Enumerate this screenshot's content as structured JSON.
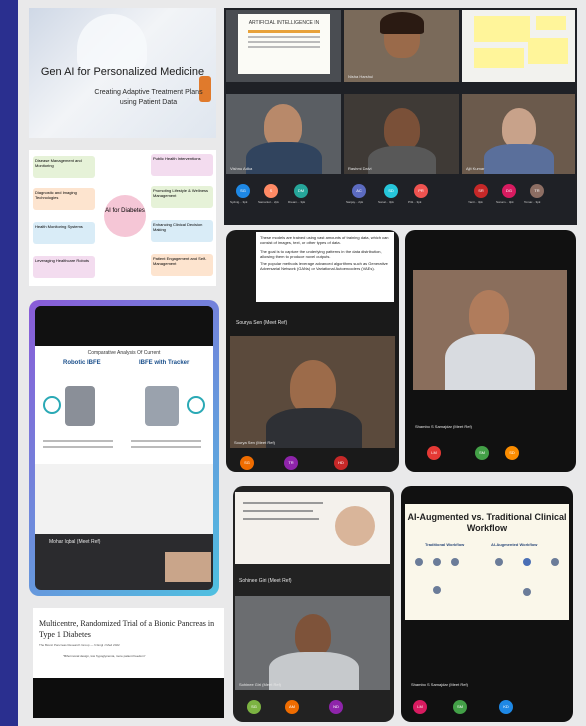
{
  "hero": {
    "title": "Gen AI for Personalized Medicine",
    "subtitle": "Creating Adaptive Treatment Plans using Patient Data"
  },
  "mindmap": {
    "center": "AI for Diabetes",
    "nodes": [
      "Disease Management and Monitoring",
      "Diagnostic and Imaging Technologies",
      "Health Monitoring Systems",
      "Leveraging Healthcare Robots",
      "Public Health Interventions",
      "Promoting Lifestyle & Wellness Management",
      "Enhancing Clinical Decision Making",
      "Patient Engagement and Self-Management"
    ]
  },
  "zoom_top": {
    "slide_title": "ARTIFICIAL INTELLIGENCE IN",
    "participants": [
      "Ashwini Nitin Mulik",
      "Nisha Harshul",
      "Vishnu Adka",
      "Rashmi Dalvi",
      "Sonal Sharma",
      "Ajit Kumar"
    ],
    "avatars": [
      {
        "initials": "SG",
        "label": "Sydnig... 3pk",
        "color": "#1e88e5"
      },
      {
        "initials": "S",
        "label": "Samantol... 2pk",
        "color": "#ff8a65"
      },
      {
        "initials": "DM",
        "label": "Dream... 3pk",
        "color": "#26a69a"
      },
      {
        "initials": "AC",
        "label": "Sanjay... 2pk",
        "color": "#5c6bc0"
      },
      {
        "initials": "SD",
        "label": "Sonal... 3pk",
        "color": "#26c6da"
      },
      {
        "initials": "PR",
        "label": "Priti... 3pk",
        "color": "#ef5350"
      },
      {
        "initials": "SR",
        "label": "Yanir... 3pk",
        "color": "#c62828"
      },
      {
        "initials": "DG",
        "label": "Sonam... 3pk",
        "color": "#d81b60"
      },
      {
        "initials": "TR",
        "label": "Tomar... 3pk",
        "color": "#8d6e63"
      }
    ]
  },
  "tablet_mid": {
    "slide_lines": [
      "These models are trained using vast amounts of training data, which can consist of images, text, or other types of data.",
      "The goal is to capture the underlying patterns in the data distribution, allowing them to produce novel outputs.",
      "The popular methods leverage advanced algorithms such as Generative Adversarial Network (GANs) or Variational Autoencoders (VAEs)."
    ],
    "host": "Sourya Sen (Meet Ref)",
    "tile_name": "Sourya Sen (Meet Ref)",
    "avatars": [
      {
        "initials": "SG",
        "color": "#ef6c00"
      },
      {
        "initials": "TR",
        "color": "#8e24aa"
      },
      {
        "initials": "HD",
        "color": "#c62828"
      }
    ]
  },
  "tablet_right": {
    "tile_name": "Shambo S Samajdar (Meet Ref)",
    "avatars": [
      {
        "initials": "LM",
        "color": "#e53935"
      },
      {
        "initials": "SM",
        "color": "#43a047"
      },
      {
        "initials": "SD",
        "color": "#fb8c00"
      }
    ]
  },
  "comparison": {
    "title": "Comparative Analysis Of Current",
    "col1": "Robotic IBFE",
    "col2": "IBFE with Tracker",
    "caption": "Mohar Iqbal (Meet Ref)"
  },
  "paper": {
    "title": "Multicentre, Randomized Trial of a Bionic Pancreas in Type 1 Diabetes",
    "meta": "The Bionic Pancreas Research Group — N Engl J Med 2022",
    "sub": "\"Bihormonal design, low hypoglycemia, more patient freedom\""
  },
  "phone_mid": {
    "top_caption": "Sohinee Giri (Meet Ref)",
    "bottom_caption": "Sohinee Giri (Meet Ref)",
    "avatars": [
      {
        "initials": "SG",
        "color": "#7cb342"
      },
      {
        "initials": "AM",
        "color": "#ef6c00"
      },
      {
        "initials": "ND",
        "color": "#8e24aa"
      }
    ]
  },
  "workflow": {
    "title": "AI-Augmented vs. Traditional Clinical Workflow",
    "col1": "Traditional Workflow",
    "col2": "AI-Augmented Workflow",
    "caption": "Shambo S Samajdar (Meet Ref)",
    "avatars": [
      {
        "initials": "LM",
        "color": "#d81b60"
      },
      {
        "initials": "SM",
        "color": "#43a047"
      },
      {
        "initials": "KD",
        "color": "#1e88e5"
      }
    ]
  }
}
